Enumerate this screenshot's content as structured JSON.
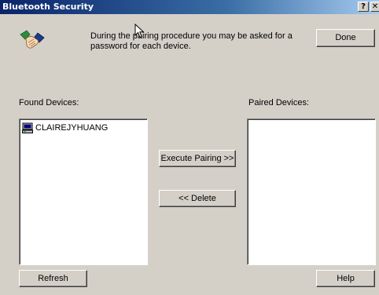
{
  "window": {
    "title": "Bluetooth Security",
    "help_button": "?",
    "close_button": "✕"
  },
  "header": {
    "instructions": "During the pairing procedure you may be asked for a password for each device.",
    "done_label": "Done",
    "icon": "handshake-icon"
  },
  "found_devices": {
    "label": "Found Devices:",
    "items": [
      {
        "name": "CLAIREJYHUANG",
        "icon": "computer-icon"
      }
    ]
  },
  "paired_devices": {
    "label": "Paired Devices:",
    "items": []
  },
  "actions": {
    "execute_pairing_label": "Execute Pairing >>",
    "delete_label": "<< Delete"
  },
  "footer": {
    "refresh_label": "Refresh",
    "help_label": "Help"
  }
}
